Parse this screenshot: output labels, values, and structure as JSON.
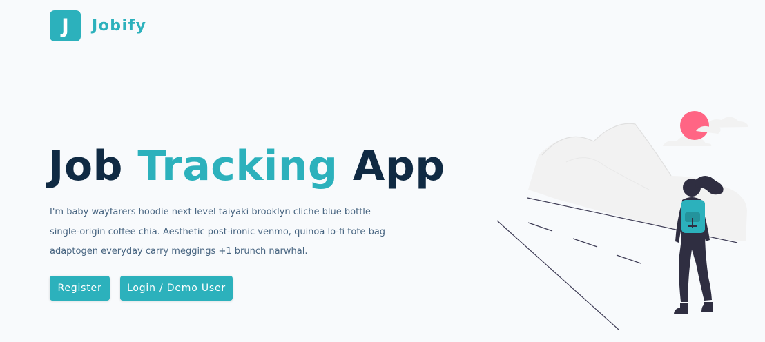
{
  "logo": {
    "letter": "J",
    "name": "Jobify"
  },
  "hero": {
    "title_part1": "Job",
    "title_accent": "Tracking",
    "title_part2": "App",
    "description": "I'm baby wayfarers hoodie next level taiyaki brooklyn cliche blue bottle single-origin coffee chia. Aesthetic post-ironic venmo, quinoa lo-fi tote bag adaptogen everyday carry meggings +1 brunch narwhal.",
    "register_label": "Register",
    "login_label": "Login / Demo User"
  },
  "colors": {
    "primary": "#2cb1bc",
    "heading": "#102a43",
    "text": "#486581",
    "background": "#f8fafc",
    "sun": "#ff6584",
    "figure_dark": "#2f2e41"
  },
  "icons": {
    "hero_illustration": "woman-hiker-illustration"
  }
}
